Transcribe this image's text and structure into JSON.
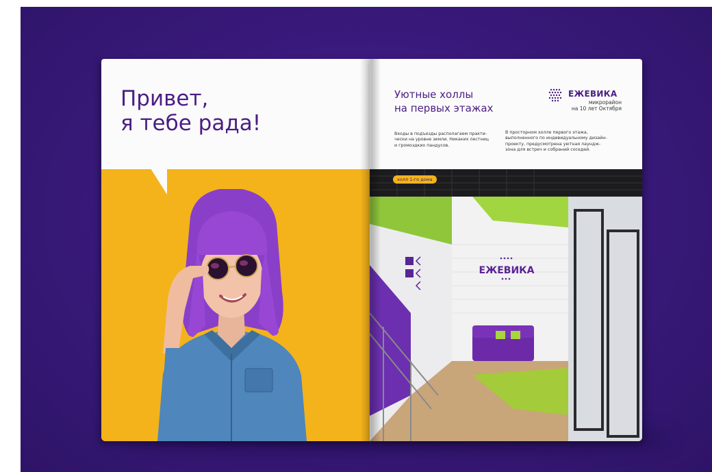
{
  "left_page": {
    "greeting_line1": "Привет,",
    "greeting_line2": "я тебе рада!"
  },
  "right_page": {
    "title_line1": "Уютные холлы",
    "title_line2": "на первых этажах",
    "brand": {
      "name": "ЕЖЕВИКА",
      "sub_line1": "микрорайон",
      "sub_line2": "на 10 лет Октября"
    },
    "text_col1": [
      "Входы в подъезды располагаем практи-",
      "чески на уровне земли. Никаких лестниц",
      "и громоздких пандусов."
    ],
    "text_col2": [
      "В просторном холле первого этажа,",
      "выполненного по индивидуальному дизайн-",
      "проекту, предусмотрена уютная лаундж-",
      "зона для встреч и собраний соседей."
    ],
    "photo_tag": "холл 1-го дома",
    "wall_logo": "ЕЖЕВИКА"
  },
  "colors": {
    "background": "#3a1a7d",
    "brand_purple": "#4b1d83",
    "accent_yellow": "#f4b31a",
    "accent_green": "#9dd12e",
    "page": "#fbfbfb"
  }
}
